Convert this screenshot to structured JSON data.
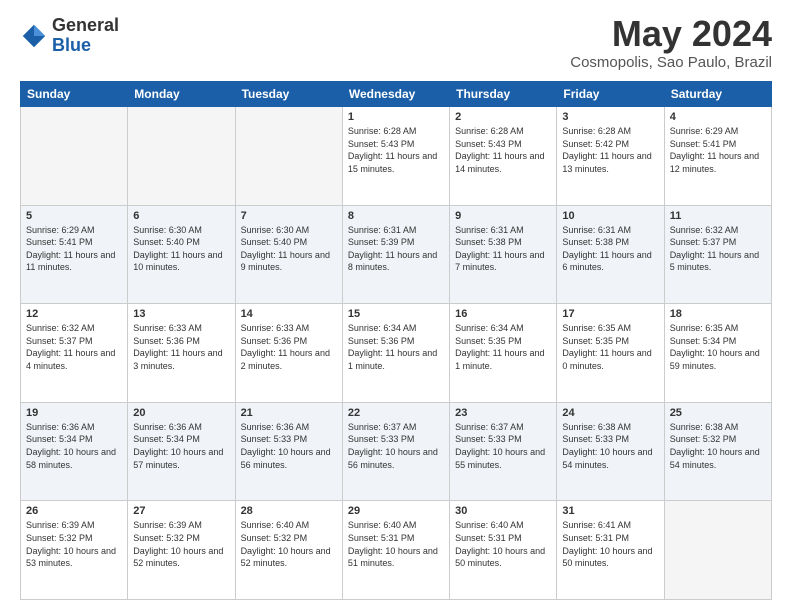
{
  "header": {
    "logo_general": "General",
    "logo_blue": "Blue",
    "month_title": "May 2024",
    "location": "Cosmopolis, Sao Paulo, Brazil"
  },
  "days_of_week": [
    "Sunday",
    "Monday",
    "Tuesday",
    "Wednesday",
    "Thursday",
    "Friday",
    "Saturday"
  ],
  "weeks": [
    [
      {
        "day": "",
        "info": ""
      },
      {
        "day": "",
        "info": ""
      },
      {
        "day": "",
        "info": ""
      },
      {
        "day": "1",
        "info": "Sunrise: 6:28 AM\nSunset: 5:43 PM\nDaylight: 11 hours and 15 minutes."
      },
      {
        "day": "2",
        "info": "Sunrise: 6:28 AM\nSunset: 5:43 PM\nDaylight: 11 hours and 14 minutes."
      },
      {
        "day": "3",
        "info": "Sunrise: 6:28 AM\nSunset: 5:42 PM\nDaylight: 11 hours and 13 minutes."
      },
      {
        "day": "4",
        "info": "Sunrise: 6:29 AM\nSunset: 5:41 PM\nDaylight: 11 hours and 12 minutes."
      }
    ],
    [
      {
        "day": "5",
        "info": "Sunrise: 6:29 AM\nSunset: 5:41 PM\nDaylight: 11 hours and 11 minutes."
      },
      {
        "day": "6",
        "info": "Sunrise: 6:30 AM\nSunset: 5:40 PM\nDaylight: 11 hours and 10 minutes."
      },
      {
        "day": "7",
        "info": "Sunrise: 6:30 AM\nSunset: 5:40 PM\nDaylight: 11 hours and 9 minutes."
      },
      {
        "day": "8",
        "info": "Sunrise: 6:31 AM\nSunset: 5:39 PM\nDaylight: 11 hours and 8 minutes."
      },
      {
        "day": "9",
        "info": "Sunrise: 6:31 AM\nSunset: 5:38 PM\nDaylight: 11 hours and 7 minutes."
      },
      {
        "day": "10",
        "info": "Sunrise: 6:31 AM\nSunset: 5:38 PM\nDaylight: 11 hours and 6 minutes."
      },
      {
        "day": "11",
        "info": "Sunrise: 6:32 AM\nSunset: 5:37 PM\nDaylight: 11 hours and 5 minutes."
      }
    ],
    [
      {
        "day": "12",
        "info": "Sunrise: 6:32 AM\nSunset: 5:37 PM\nDaylight: 11 hours and 4 minutes."
      },
      {
        "day": "13",
        "info": "Sunrise: 6:33 AM\nSunset: 5:36 PM\nDaylight: 11 hours and 3 minutes."
      },
      {
        "day": "14",
        "info": "Sunrise: 6:33 AM\nSunset: 5:36 PM\nDaylight: 11 hours and 2 minutes."
      },
      {
        "day": "15",
        "info": "Sunrise: 6:34 AM\nSunset: 5:36 PM\nDaylight: 11 hours and 1 minute."
      },
      {
        "day": "16",
        "info": "Sunrise: 6:34 AM\nSunset: 5:35 PM\nDaylight: 11 hours and 1 minute."
      },
      {
        "day": "17",
        "info": "Sunrise: 6:35 AM\nSunset: 5:35 PM\nDaylight: 11 hours and 0 minutes."
      },
      {
        "day": "18",
        "info": "Sunrise: 6:35 AM\nSunset: 5:34 PM\nDaylight: 10 hours and 59 minutes."
      }
    ],
    [
      {
        "day": "19",
        "info": "Sunrise: 6:36 AM\nSunset: 5:34 PM\nDaylight: 10 hours and 58 minutes."
      },
      {
        "day": "20",
        "info": "Sunrise: 6:36 AM\nSunset: 5:34 PM\nDaylight: 10 hours and 57 minutes."
      },
      {
        "day": "21",
        "info": "Sunrise: 6:36 AM\nSunset: 5:33 PM\nDaylight: 10 hours and 56 minutes."
      },
      {
        "day": "22",
        "info": "Sunrise: 6:37 AM\nSunset: 5:33 PM\nDaylight: 10 hours and 56 minutes."
      },
      {
        "day": "23",
        "info": "Sunrise: 6:37 AM\nSunset: 5:33 PM\nDaylight: 10 hours and 55 minutes."
      },
      {
        "day": "24",
        "info": "Sunrise: 6:38 AM\nSunset: 5:33 PM\nDaylight: 10 hours and 54 minutes."
      },
      {
        "day": "25",
        "info": "Sunrise: 6:38 AM\nSunset: 5:32 PM\nDaylight: 10 hours and 54 minutes."
      }
    ],
    [
      {
        "day": "26",
        "info": "Sunrise: 6:39 AM\nSunset: 5:32 PM\nDaylight: 10 hours and 53 minutes."
      },
      {
        "day": "27",
        "info": "Sunrise: 6:39 AM\nSunset: 5:32 PM\nDaylight: 10 hours and 52 minutes."
      },
      {
        "day": "28",
        "info": "Sunrise: 6:40 AM\nSunset: 5:32 PM\nDaylight: 10 hours and 52 minutes."
      },
      {
        "day": "29",
        "info": "Sunrise: 6:40 AM\nSunset: 5:31 PM\nDaylight: 10 hours and 51 minutes."
      },
      {
        "day": "30",
        "info": "Sunrise: 6:40 AM\nSunset: 5:31 PM\nDaylight: 10 hours and 50 minutes."
      },
      {
        "day": "31",
        "info": "Sunrise: 6:41 AM\nSunset: 5:31 PM\nDaylight: 10 hours and 50 minutes."
      },
      {
        "day": "",
        "info": ""
      }
    ]
  ]
}
